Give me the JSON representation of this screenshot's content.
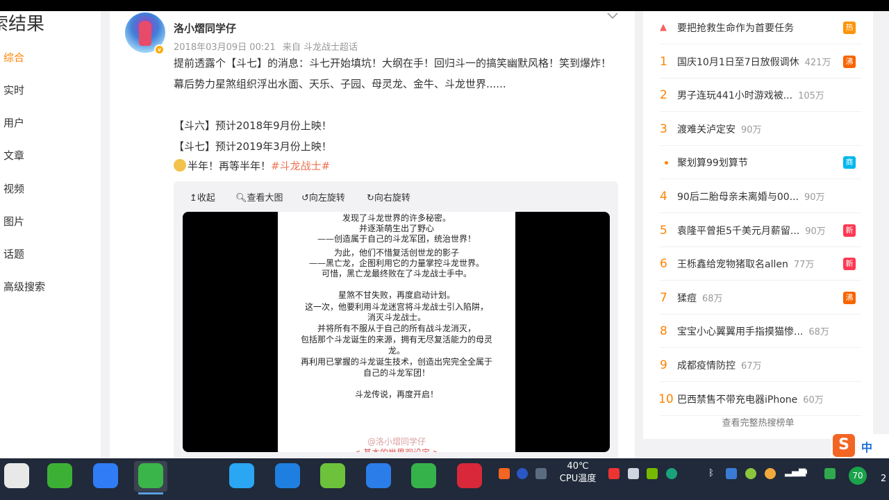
{
  "left_nav": {
    "title": "索结果",
    "items": [
      "综合",
      "实时",
      "用户",
      "文章",
      "视频",
      "图片",
      "话题",
      "高级搜索"
    ]
  },
  "post": {
    "author": "洛小熠同学仔",
    "date": "2018年03月09日 00:21",
    "source": "来自 斗龙战士超话",
    "text": "提前透露个【斗七】的消息：斗七开始填坑！大纲在手！回归斗一的搞笑幽默风格！笑到爆炸！幕后势力星煞组织浮出水面、天乐、子园、母灵龙、金牛、斗龙世界......",
    "line1": "【斗六】预计2018年9月份上映！",
    "line2": "【斗七】预计2019年3月份上映！",
    "line3": "半年！再等半年！",
    "hashtag": "#斗龙战士#",
    "media_tools": [
      "收起",
      "查看大图",
      "向左旋转",
      "向右旋转"
    ],
    "image_lines": [
      "发现了斗龙世界的许多秘密。",
      "并逐渐萌生出了野心",
      "——创造属于自己的斗龙军团，统治世界！",
      "",
      "为此，他们不惜复活创世龙的影子",
      "——黑亡龙，企图利用它的力量掌控斗龙世界。",
      "可惜，黑亡龙最终败在了斗龙战士手中。",
      "",
      "星煞不甘失败，再度启动计划。",
      "这一次，他要利用斗龙迷宫将斗龙战士引入陷阱，",
      "消灭斗龙战士。",
      "并将所有不服从于自己的所有战斗龙消灭，",
      "包括那个斗龙诞生的来源，拥有无尽复活能力的母灵",
      "龙。",
      "再利用已掌握的斗龙诞生技术，创造出完完全全属于",
      "自己的斗龙军团！",
      "",
      "斗龙传说，再度开启！"
    ],
    "image_watermark": "@洛小熠同学仔",
    "image_footer": "< 基本的世界观设定 >"
  },
  "hot_list": {
    "items": [
      {
        "rank": "top",
        "text": "要把抢救生命作为首要任务",
        "heat": "",
        "badge": "热",
        "badge_color": "#ff9406"
      },
      {
        "rank": "1",
        "text": "国庆10月1日至7日放假调休",
        "heat": "421万",
        "badge": "沸",
        "badge_color": "#f86400"
      },
      {
        "rank": "2",
        "text": "男子连玩441小时游戏被...",
        "heat": "105万",
        "badge": "",
        "badge_color": ""
      },
      {
        "rank": "3",
        "text": "渡难关泸定安",
        "heat": "90万",
        "badge": "",
        "badge_color": ""
      },
      {
        "rank": "dot",
        "text": "聚划算99划算节",
        "heat": "",
        "badge": "商",
        "badge_color": "#00b7ee"
      },
      {
        "rank": "4",
        "text": "90后二胎母亲未离婚与00...",
        "heat": "90万",
        "badge": "",
        "badge_color": ""
      },
      {
        "rank": "5",
        "text": "袁隆平曾拒5千美元月薪留...",
        "heat": "90万",
        "badge": "新",
        "badge_color": "#ff3852"
      },
      {
        "rank": "6",
        "text": "王栎鑫给宠物猪取名allen",
        "heat": "77万",
        "badge": "新",
        "badge_color": "#ff3852"
      },
      {
        "rank": "7",
        "text": "猱痘",
        "heat": "68万",
        "badge": "沸",
        "badge_color": "#f86400"
      },
      {
        "rank": "8",
        "text": "宝宝小心翼翼用手指摸猫惨...",
        "heat": "68万",
        "badge": "",
        "badge_color": ""
      },
      {
        "rank": "9",
        "text": "成都疫情防控",
        "heat": "67万",
        "badge": "",
        "badge_color": ""
      },
      {
        "rank": "10",
        "text": "巴西禁售不带充电器iPhone",
        "heat": "60万",
        "badge": "",
        "badge_color": ""
      }
    ],
    "more_link": "查看完整热搜榜单"
  },
  "ime": {
    "logo": "S",
    "mode": "中"
  },
  "taskbar": {
    "apps": [
      {
        "name": "youku-app",
        "color": "#e8e8e8"
      },
      {
        "name": "wechat-app",
        "color": "#3cb034"
      },
      {
        "name": "feishu-app",
        "color": "#2f7cf6"
      },
      {
        "name": "browser-360-app",
        "color": "#3ab54a"
      },
      {
        "name": "camera-app",
        "color": "#202a3a"
      },
      {
        "name": "player-app",
        "color": "#2aa6f2"
      },
      {
        "name": "video-editor-app",
        "color": "#1f7fe0"
      },
      {
        "name": "security-360-app",
        "color": "#6cc23a"
      },
      {
        "name": "flash-app",
        "color": "#2b7de9"
      },
      {
        "name": "wifi-app",
        "color": "#35b34a"
      },
      {
        "name": "recorder-app",
        "color": "#d8283a"
      }
    ],
    "temperature": "40℃",
    "temperature_label": "CPU温度",
    "cpu_badge": "70",
    "clock_partial": "2"
  }
}
